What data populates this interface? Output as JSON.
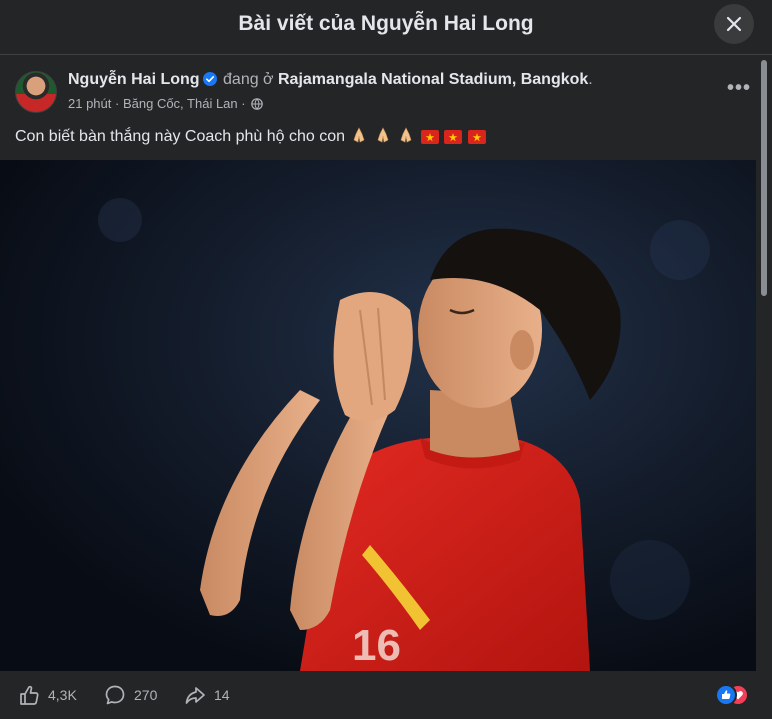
{
  "header": {
    "title": "Bài viết của Nguyễn Hai Long",
    "close_icon": "close-icon"
  },
  "post": {
    "author_name": "Nguyễn Hai Long",
    "verified_icon": "verified-badge-icon",
    "at_text": "đang ở",
    "location": "Rajamangala National Stadium, Bangkok",
    "location_suffix": ".",
    "time": "21 phút",
    "sep1": "·",
    "place": "Băng Cốc, Thái Lan",
    "sep2": "·",
    "privacy_icon": "globe-icon",
    "more_label": "•••",
    "text": "Con biết bàn thắng này Coach phù hộ cho con",
    "emojis": [
      "folded-hands",
      "folded-hands",
      "folded-hands",
      "vietnam-flag",
      "vietnam-flag",
      "vietnam-flag"
    ]
  },
  "actions": {
    "like_count": "4,3K",
    "comment_count": "270",
    "share_count": "14"
  },
  "colors": {
    "background": "#242526",
    "text": "#e4e6eb",
    "secondary": "#b0b3b8",
    "verified": "#1877f2",
    "jersey": "#d9231d"
  }
}
